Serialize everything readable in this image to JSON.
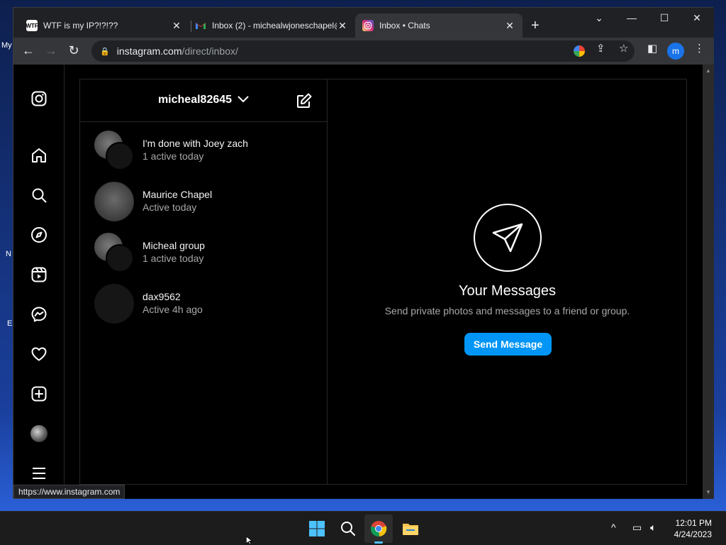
{
  "desktop": {
    "icon_labels": [
      "My",
      "N",
      "E"
    ]
  },
  "browser": {
    "tabs": [
      {
        "title": "WTF is my IP?!?!??",
        "favicon": "wtf-favicon",
        "active": false
      },
      {
        "title": "Inbox (2) - michealwjoneschapel@",
        "favicon": "gmail-icon",
        "active": false
      },
      {
        "title": "Inbox • Chats",
        "favicon": "instagram-icon",
        "active": true
      }
    ],
    "url_host": "instagram.com",
    "url_path": "/direct/inbox/",
    "profile_initial": "m",
    "status_url": "https://www.instagram.com"
  },
  "instagram": {
    "nav_icons": [
      "instagram-logo-icon",
      "home-icon",
      "search-icon",
      "explore-icon",
      "reels-icon",
      "messenger-icon",
      "heart-icon",
      "create-icon",
      "profile-avatar",
      "menu-icon"
    ],
    "username": "micheal82645",
    "conversations": [
      {
        "name": "I'm done with Joey zach",
        "status": "1 active today",
        "avatar": "group"
      },
      {
        "name": "Maurice Chapel",
        "status": "Active today",
        "avatar": "single"
      },
      {
        "name": "Micheal group",
        "status": "1 active today",
        "avatar": "group"
      },
      {
        "name": "dax9562",
        "status": "Active 4h ago",
        "avatar": "dark"
      }
    ],
    "empty_state": {
      "title": "Your Messages",
      "subtitle": "Send private photos and messages to a friend or group.",
      "button": "Send Message"
    },
    "accent": "#0095f6"
  },
  "taskbar": {
    "time": "12:01 PM",
    "date": "4/24/2023"
  }
}
